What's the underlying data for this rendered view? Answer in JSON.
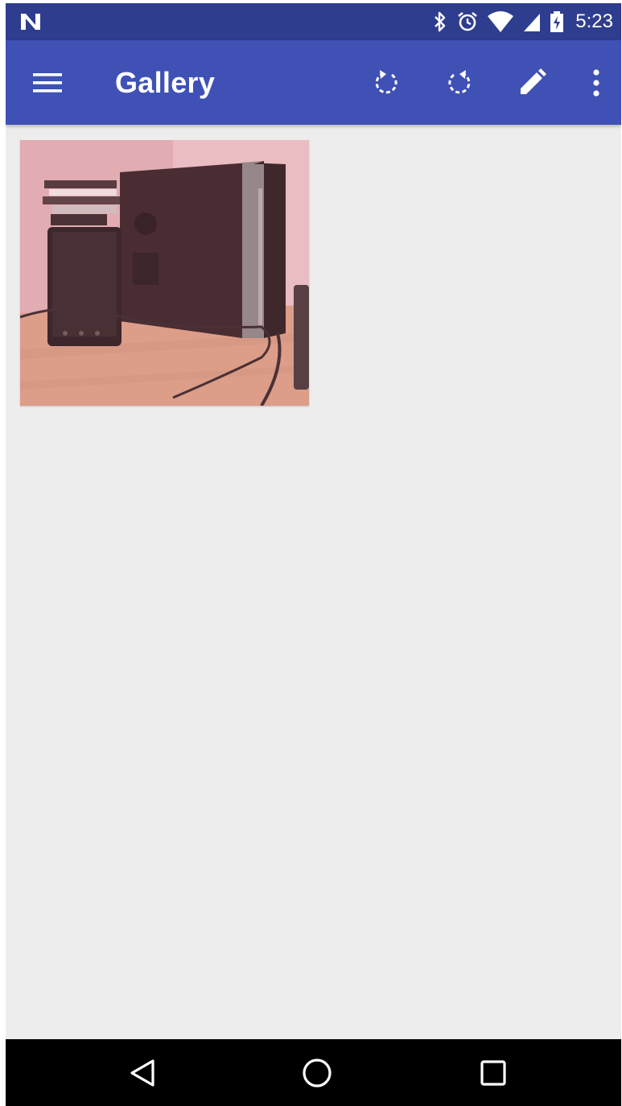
{
  "status_bar": {
    "time": "5:23",
    "icons": [
      "notification-n-icon",
      "bluetooth-icon",
      "alarm-icon",
      "wifi-icon",
      "cell-signal-icon",
      "battery-charging-icon"
    ]
  },
  "app_bar": {
    "title": "Gallery",
    "actions": [
      "menu-icon",
      "rotate-left-icon",
      "rotate-right-icon",
      "edit-pencil-icon",
      "more-vert-icon"
    ]
  },
  "gallery": {
    "items": [
      {
        "description_icon": "photo-thumbnail"
      }
    ]
  },
  "nav_bar": {
    "buttons": [
      "back-icon",
      "home-icon",
      "recents-icon"
    ]
  },
  "colors": {
    "status_bar": "#2f3d8e",
    "app_bar": "#3f51b5",
    "background": "#ededed",
    "nav_bar": "#000000"
  }
}
